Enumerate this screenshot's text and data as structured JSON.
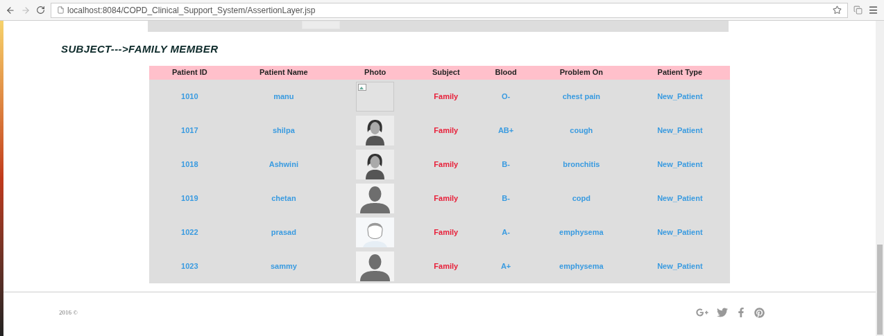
{
  "browser": {
    "url": "localhost:8084/COPD_Clinical_Support_System/AssertionLayer.jsp"
  },
  "heading": "SUBJECT--->FAMILY MEMBER",
  "table": {
    "columns": [
      "Patient ID",
      "Patient Name",
      "Photo",
      "Subject",
      "Blood",
      "Problem On",
      "Patient Type"
    ],
    "rows": [
      {
        "id": "1010",
        "name": "manu",
        "photo": {
          "kind": "broken"
        },
        "subject": "Family",
        "blood": "O-",
        "problem": "chest pain",
        "type": "New_Patient"
      },
      {
        "id": "1017",
        "name": "shilpa",
        "photo": {
          "kind": "female"
        },
        "subject": "Family",
        "blood": "AB+",
        "problem": "cough",
        "type": "New_Patient"
      },
      {
        "id": "1018",
        "name": "Ashwini",
        "photo": {
          "kind": "female"
        },
        "subject": "Family",
        "blood": "B-",
        "problem": "bronchitis",
        "type": "New_Patient"
      },
      {
        "id": "1019",
        "name": "chetan",
        "photo": {
          "kind": "male"
        },
        "subject": "Family",
        "blood": "B-",
        "problem": "copd",
        "type": "New_Patient"
      },
      {
        "id": "1022",
        "name": "prasad",
        "photo": {
          "kind": "sketch"
        },
        "subject": "Family",
        "blood": "A-",
        "problem": "emphysema",
        "type": "New_Patient"
      },
      {
        "id": "1023",
        "name": "sammy",
        "photo": {
          "kind": "male"
        },
        "subject": "Family",
        "blood": "A+",
        "problem": "emphysema",
        "type": "New_Patient"
      }
    ]
  },
  "footer": {
    "copyright": "2016 ©"
  }
}
